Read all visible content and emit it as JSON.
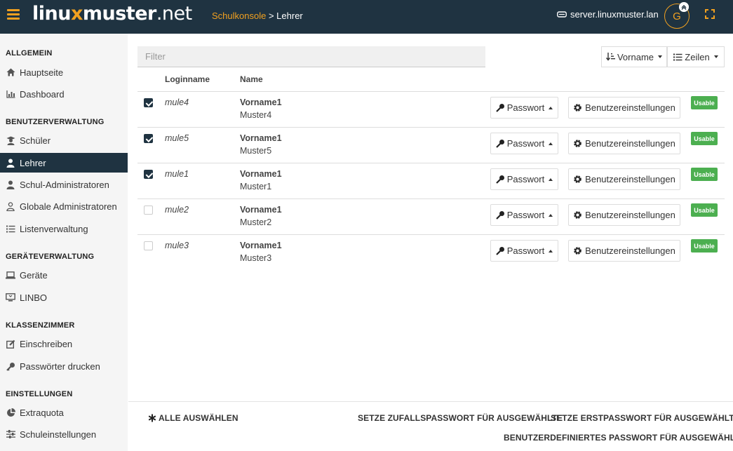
{
  "header": {
    "logo_main": "linu",
    "logo_x": "x",
    "logo_rest": "muster",
    "logo_tld": ".net",
    "breadcrumb_link": "Schulkonsole",
    "breadcrumb_sep": ">",
    "breadcrumb_current": "Lehrer",
    "server": "server.linuxmuster.lan",
    "avatar_letter": "G",
    "accent_color": "#f0a020",
    "bar_color": "#1f3341"
  },
  "sidebar": {
    "sections": [
      {
        "title": "ALLGEMEIN",
        "items": [
          {
            "label": "Hauptseite",
            "icon": "home-icon"
          },
          {
            "label": "Dashboard",
            "icon": "bar-chart-icon"
          }
        ]
      },
      {
        "title": "BENUTZERVERWALTUNG",
        "items": [
          {
            "label": "Schüler",
            "icon": "student-icon"
          },
          {
            "label": "Lehrer",
            "icon": "user-icon",
            "active": true
          },
          {
            "label": "Schul-Administratoren",
            "icon": "user-icon"
          },
          {
            "label": "Globale Administratoren",
            "icon": "user-outline-icon"
          },
          {
            "label": "Listenverwaltung",
            "icon": "list-icon"
          }
        ]
      },
      {
        "title": "GERÄTEVERWALTUNG",
        "items": [
          {
            "label": "Geräte",
            "icon": "laptop-icon"
          },
          {
            "label": "LINBO",
            "icon": "monitor-icon"
          }
        ]
      },
      {
        "title": "KLASSENZIMMER",
        "items": [
          {
            "label": "Einschreiben",
            "icon": "edit-icon"
          },
          {
            "label": "Passwörter drucken",
            "icon": "key-icon"
          }
        ]
      },
      {
        "title": "EINSTELLUNGEN",
        "items": [
          {
            "label": "Extraquota",
            "icon": "pie-chart-icon"
          },
          {
            "label": "Schuleinstellungen",
            "icon": "sliders-icon"
          }
        ]
      }
    ]
  },
  "toolbar": {
    "filter_placeholder": "Filter",
    "sort_label": "Vorname",
    "rows_label": "Zeilen"
  },
  "table": {
    "headers": {
      "login": "Loginname",
      "name": "Name"
    },
    "password_label": "Passwort",
    "settings_label": "Benutzereinstellungen",
    "rows": [
      {
        "checked": true,
        "login": "mule4",
        "first": "Vorname1",
        "last": "Muster4",
        "status": "Usable"
      },
      {
        "checked": true,
        "login": "mule5",
        "first": "Vorname1",
        "last": "Muster5",
        "status": "Usable"
      },
      {
        "checked": true,
        "login": "mule1",
        "first": "Vorname1",
        "last": "Muster1",
        "status": "Usable"
      },
      {
        "checked": false,
        "login": "mule2",
        "first": "Vorname1",
        "last": "Muster2",
        "status": "Usable"
      },
      {
        "checked": false,
        "login": "mule3",
        "first": "Vorname1",
        "last": "Muster3",
        "status": "Usable"
      }
    ]
  },
  "footer": {
    "select_all": "ALLE AUSWÄHLEN",
    "random_pw": "SETZE ZUFALLSPASSWORT FÜR AUSGEWÄHLTE",
    "first_pw": "SETZE ERSTPASSWORT FÜR AUSGEWÄHLTE",
    "custom_pw": "BENUTZERDEFINIERTES PASSWORT FÜR AUSGEWÄHLTE"
  }
}
